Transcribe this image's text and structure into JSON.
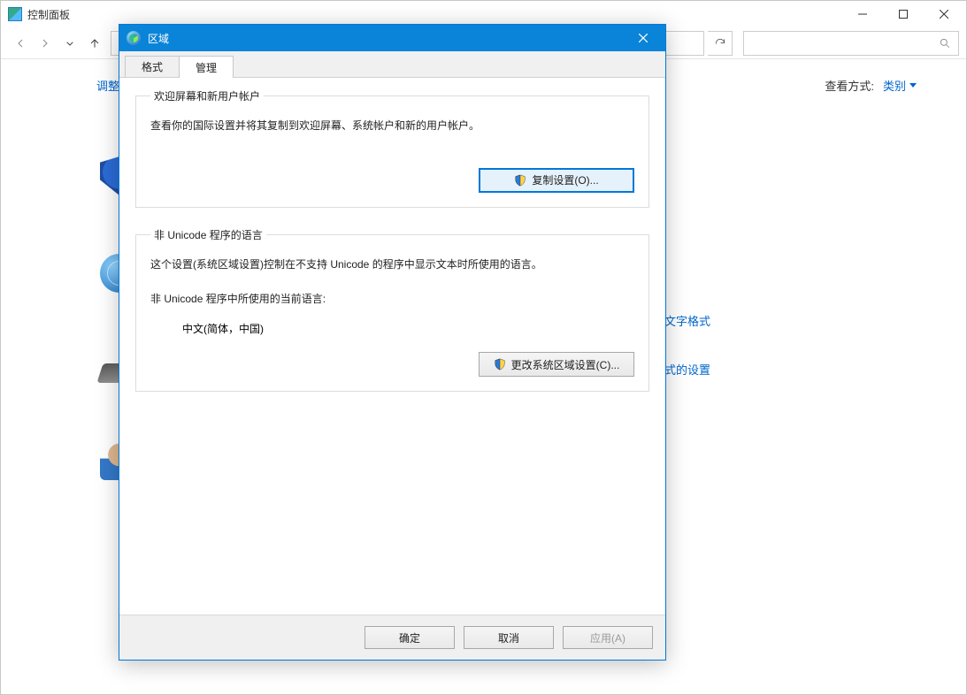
{
  "parent": {
    "title": "控制面板",
    "adjust_label": "调整",
    "view_label": "查看方式:",
    "view_value": "类别",
    "links": [
      "文字格式",
      "式的设置"
    ],
    "icons": [
      "shield-icon",
      "globe-icon",
      "hardware-icon",
      "user-icon"
    ]
  },
  "dialog": {
    "title": "区域",
    "tabs": {
      "format": "格式",
      "admin": "管理"
    },
    "section1": {
      "legend": "欢迎屏幕和新用户帐户",
      "desc": "查看你的国际设置并将其复制到欢迎屏幕、系统帐户和新的用户帐户。",
      "button": "复制设置(O)..."
    },
    "section2": {
      "legend": "非 Unicode 程序的语言",
      "desc": "这个设置(系统区域设置)控制在不支持 Unicode 的程序中显示文本时所使用的语言。",
      "sublabel": "非 Unicode 程序中所使用的当前语言:",
      "value": "中文(简体，中国)",
      "button": "更改系统区域设置(C)..."
    },
    "footer": {
      "ok": "确定",
      "cancel": "取消",
      "apply": "应用(A)"
    }
  }
}
